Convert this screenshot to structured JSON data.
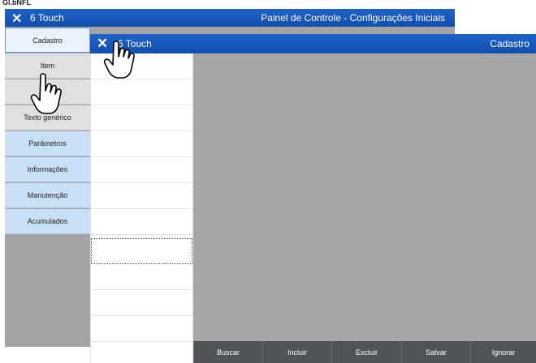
{
  "top_label": "Gl.bNFL",
  "background_window": {
    "app_name": "6 Touch",
    "title": "Painel de Controle - Configurações Iniciais",
    "menu": [
      {
        "label": "Cadastro"
      },
      {
        "label": "Item"
      },
      {
        "label": "ado"
      },
      {
        "label": "Texto genérico"
      },
      {
        "label": "Parâmetros"
      },
      {
        "label": "Informações"
      },
      {
        "label": "Manutenção"
      },
      {
        "label": "Acumulados"
      }
    ]
  },
  "dialog": {
    "app_name": "6 Touch",
    "title": "Cadastro",
    "buttons": [
      "Buscar",
      "Incluir",
      "Excluir",
      "Salvar",
      "Ignorar"
    ]
  },
  "icons": {
    "close": "close-icon",
    "pointer": "hand-pointer-icon"
  },
  "colors": {
    "header": "#1a5cc0",
    "menu_blue": "#c9dff5",
    "menu_gray": "#e0e0e0",
    "panel": "#a6a6a6",
    "buttons": "#4f5357"
  }
}
